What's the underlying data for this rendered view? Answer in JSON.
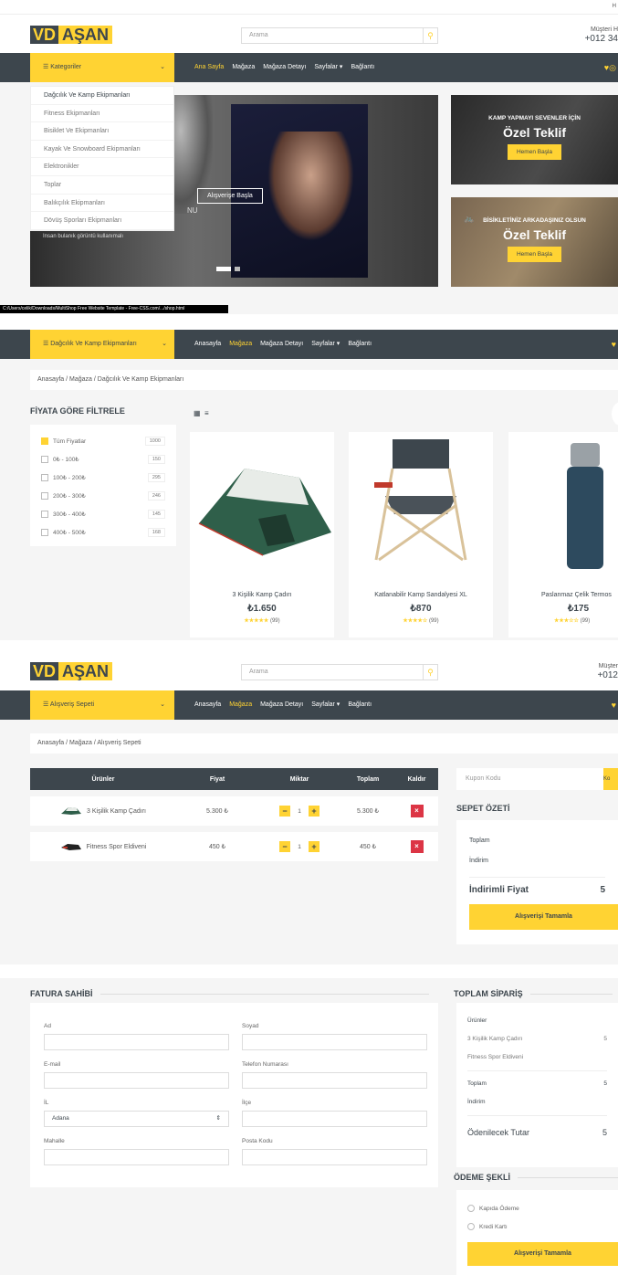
{
  "header1": {
    "logo_part1": "VD",
    "logo_part2": "AŞAN",
    "search_placeholder": "Arama",
    "contact_label": "Müşteri H",
    "contact_phone": "+012 34",
    "topbar_text": "H"
  },
  "nav1": {
    "categories_label": "Kategoriler",
    "links": [
      "Ana Sayfa",
      "Mağaza",
      "Mağaza Detayı",
      "Sayfalar ▾",
      "Bağlantı"
    ]
  },
  "dropdown": {
    "items": [
      "Dağcılık Ve Kamp Ekipmanları",
      "Fitness Ekipmanları",
      "Bisiklet Ve Ekipmanları",
      "Kayak Ve Snowboard Ekipmanları",
      "Elektronikler",
      "Toplar",
      "Balıkçılık Ekipmanları",
      "Dövüş Sporları Ekipmanları"
    ]
  },
  "hero": {
    "button": "Alışverişe Başla",
    "subtext": "Insan bulanık görüntü kullanımalı",
    "side_text": "NU"
  },
  "offers": [
    {
      "small": "KAMP YAPMAYI SEVENLER İÇİN",
      "big": "Özel Teklif",
      "button": "Hemen Başla"
    },
    {
      "small": "BİSİKLETİNİZ ARKADAŞINIZ OLSUN",
      "big": "Özel Teklif",
      "button": "Hemen Başla"
    }
  ],
  "statusbar": "C:/Users/celik/Downloads/MultiShop Free Website Template - Free-CSS.com/.../shop.html",
  "nav2": {
    "categories_label": "Dağcılık Ve Kamp Ekipmanları",
    "links": [
      "Anasayfa",
      "Mağaza",
      "Mağaza Detayı",
      "Sayfalar ▾",
      "Bağlantı"
    ]
  },
  "shop": {
    "breadcrumb": "Anasayfa  /  Mağaza  /  Dağcılık Ve Kamp Ekipmanları",
    "filter_title": "FİYATA GÖRE FİLTRELE",
    "filters": [
      {
        "label": "Tüm Fiyatlar",
        "count": "1000",
        "checked": true
      },
      {
        "label": "0₺ - 100₺",
        "count": "150",
        "checked": false
      },
      {
        "label": "100₺ - 200₺",
        "count": "295",
        "checked": false
      },
      {
        "label": "200₺ - 300₺",
        "count": "246",
        "checked": false
      },
      {
        "label": "300₺ - 400₺",
        "count": "145",
        "checked": false
      },
      {
        "label": "400₺ - 500₺",
        "count": "168",
        "checked": false
      }
    ],
    "products": [
      {
        "name": "3 Kişilik Kamp Çadırı",
        "price": "₺1.650",
        "stars": "★★★★★",
        "reviews": "(99)"
      },
      {
        "name": "Katlanabilir Kamp Sandalyesi XL",
        "price": "₺870",
        "stars": "★★★★☆",
        "reviews": "(99)"
      },
      {
        "name": "Paslanmaz Çelik Termos",
        "price": "₺175",
        "stars": "★★★☆☆",
        "reviews": "(99)"
      }
    ]
  },
  "header3": {
    "logo_part1": "VD",
    "logo_part2": "AŞAN",
    "search_placeholder": "Arama",
    "contact_label": "Müşter",
    "contact_phone": "+012"
  },
  "nav3": {
    "categories_label": "Alışveriş Sepeti",
    "links": [
      "Anasayfa",
      "Mağaza",
      "Mağaza Detayı",
      "Sayfalar ▾",
      "Bağlantı"
    ]
  },
  "cart": {
    "breadcrumb": "Anasayfa  /  Mağaza  /  Alışveriş Sepeti",
    "headers": [
      "Ürünler",
      "Fiyat",
      "Miktar",
      "Toplam",
      "Kaldır"
    ],
    "rows": [
      {
        "name": "3 Kişilik Kamp Çadırı",
        "price": "5.300 ₺",
        "qty": "1",
        "total": "5.300 ₺"
      },
      {
        "name": "Fitness Spor Eldiveni",
        "price": "450 ₺",
        "qty": "1",
        "total": "450 ₺"
      }
    ],
    "coupon_placeholder": "Kupon Kodu",
    "coupon_button": "Ko",
    "summary_title": "SEPET ÖZETİ",
    "summary_total_label": "Toplam",
    "summary_discount_label": "İndirim",
    "summary_discounted_label": "İndirimli Fiyat",
    "summary_discounted_value": "5",
    "checkout_button": "Alışverişi Tamamla"
  },
  "checkout": {
    "billing_title": "FATURA SAHİBİ",
    "labels": {
      "ad": "Ad",
      "soyad": "Soyad",
      "email": "E-mail",
      "telefon": "Telefon Numarası",
      "il": "İL",
      "ilce": "İlçe",
      "mahalle": "Mahalle",
      "posta": "Posta Kodu"
    },
    "il_value": "Adana",
    "order_title": "TOPLAM SİPARİŞ",
    "order_products_label": "Ürünler",
    "order_items": [
      {
        "name": "3 Kişilik Kamp Çadırı",
        "value": "5"
      },
      {
        "name": "Fitness Spor Eldiveni",
        "value": ""
      }
    ],
    "order_total_label": "Toplam",
    "order_total_value": "5",
    "order_discount_label": "İndirim",
    "order_payable_label": "Ödenilecek Tutar",
    "order_payable_value": "5",
    "payment_title": "ÖDEME ŞEKLİ",
    "payment_options": [
      "Kapıda Ödeme",
      "Kredi Kartı"
    ],
    "complete_button": "Alışverişi Tamamla"
  },
  "colors": {
    "accent": "#ffd333",
    "dark": "#3d464d",
    "bg": "#f5f5f5",
    "danger": "#dc3545"
  }
}
